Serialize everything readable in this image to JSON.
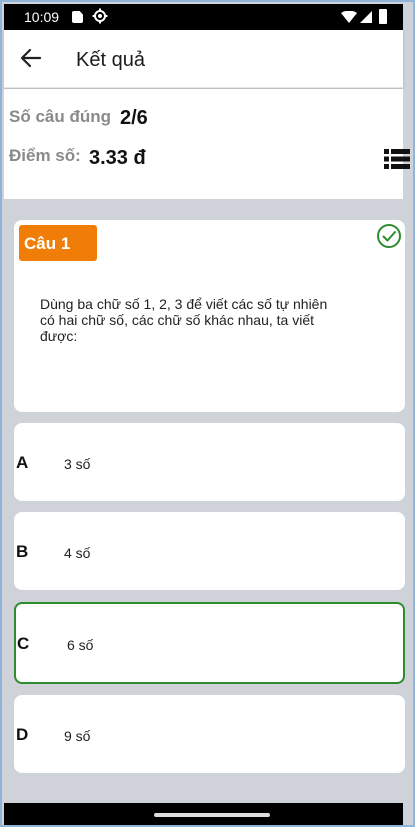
{
  "status_bar": {
    "time": "10:09"
  },
  "app_bar": {
    "title": "Kết quả"
  },
  "summary": {
    "correct_label": "Số câu đúng",
    "correct_value": "2/6",
    "score_label": "Điểm số:",
    "score_value": "3.33 đ"
  },
  "question": {
    "badge": "Câu 1",
    "text": "Dùng ba chữ số 1, 2, 3 để viết các số tự nhiên có hai chữ số, các chữ số khác nhau, ta viết được:"
  },
  "options": [
    {
      "letter": "A",
      "text": "3 số"
    },
    {
      "letter": "B",
      "text": "4 số"
    },
    {
      "letter": "C",
      "text": "6 số"
    },
    {
      "letter": "D",
      "text": "9 số"
    }
  ],
  "colors": {
    "badge": "#ef7d08",
    "correct": "#2e8b2e",
    "background": "#cfd3d9"
  },
  "icons": {
    "back": "back-arrow-icon",
    "list": "list-view-icon",
    "check": "check-circle-icon"
  }
}
